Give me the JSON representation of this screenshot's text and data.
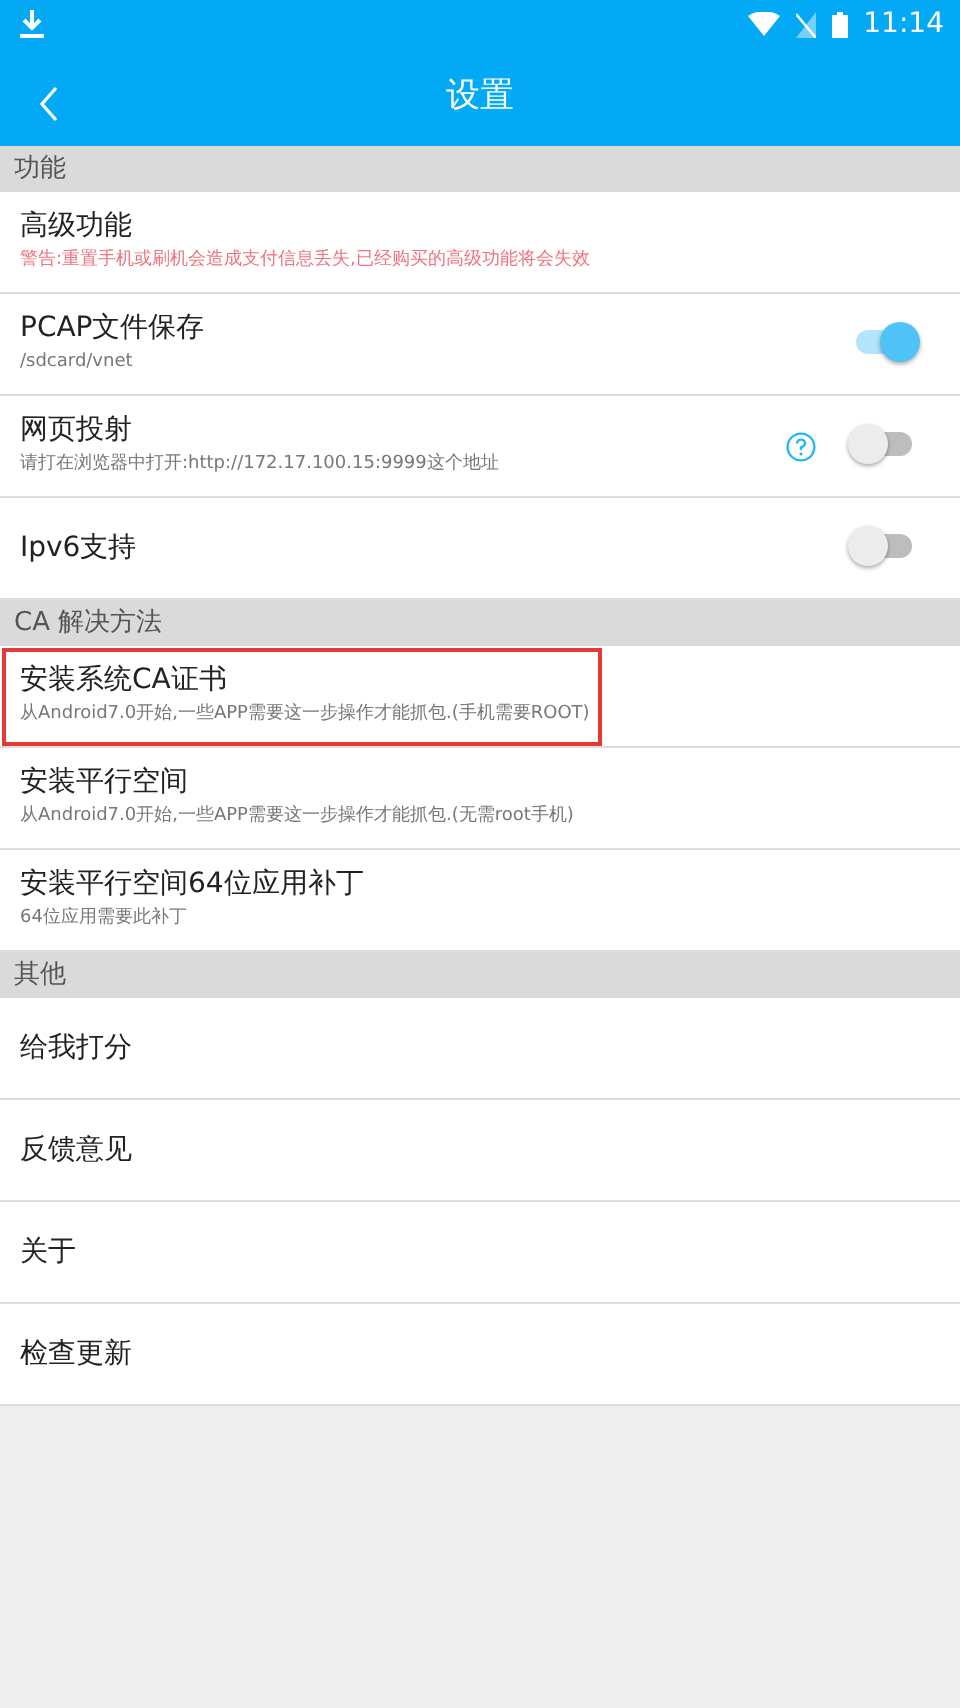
{
  "status_bar": {
    "time": "11:14"
  },
  "app_bar": {
    "title": "设置"
  },
  "sections": [
    {
      "header": "功能",
      "items": [
        {
          "kind": "plain",
          "title": "高级功能",
          "subtitle": "警告:重置手机或刷机会造成支付信息丢失,已经购买的高级功能将会失效",
          "warning": true,
          "highlighted": false
        },
        {
          "kind": "switch",
          "title": "PCAP文件保存",
          "subtitle": "/sdcard/vnet",
          "on": true,
          "help": false,
          "highlighted": false
        },
        {
          "kind": "switch",
          "title": "网页投射",
          "subtitle": "请打在浏览器中打开:http://172.17.100.15:9999这个地址",
          "on": false,
          "help": true,
          "highlighted": false
        },
        {
          "kind": "switch",
          "title": "Ipv6支持",
          "on": false,
          "help": false,
          "highlighted": false
        }
      ]
    },
    {
      "header": "CA 解决方法",
      "items": [
        {
          "kind": "plain",
          "title": "安装系统CA证书",
          "subtitle": "从Android7.0开始,一些APP需要这一步操作才能抓包.(手机需要ROOT)",
          "warning": false,
          "highlighted": true
        },
        {
          "kind": "plain",
          "title": "安装平行空间",
          "subtitle": "从Android7.0开始,一些APP需要这一步操作才能抓包.(无需root手机)",
          "warning": false,
          "highlighted": false
        },
        {
          "kind": "plain",
          "title": "安装平行空间64位应用补丁",
          "subtitle": "64位应用需要此补丁",
          "warning": false,
          "highlighted": false
        }
      ]
    },
    {
      "header": "其他",
      "items": [
        {
          "kind": "plain",
          "title": "给我打分",
          "highlighted": false
        },
        {
          "kind": "plain",
          "title": "反馈意见",
          "highlighted": false
        },
        {
          "kind": "plain",
          "title": "关于",
          "highlighted": false
        },
        {
          "kind": "plain",
          "title": "检查更新",
          "highlighted": false
        }
      ]
    }
  ]
}
